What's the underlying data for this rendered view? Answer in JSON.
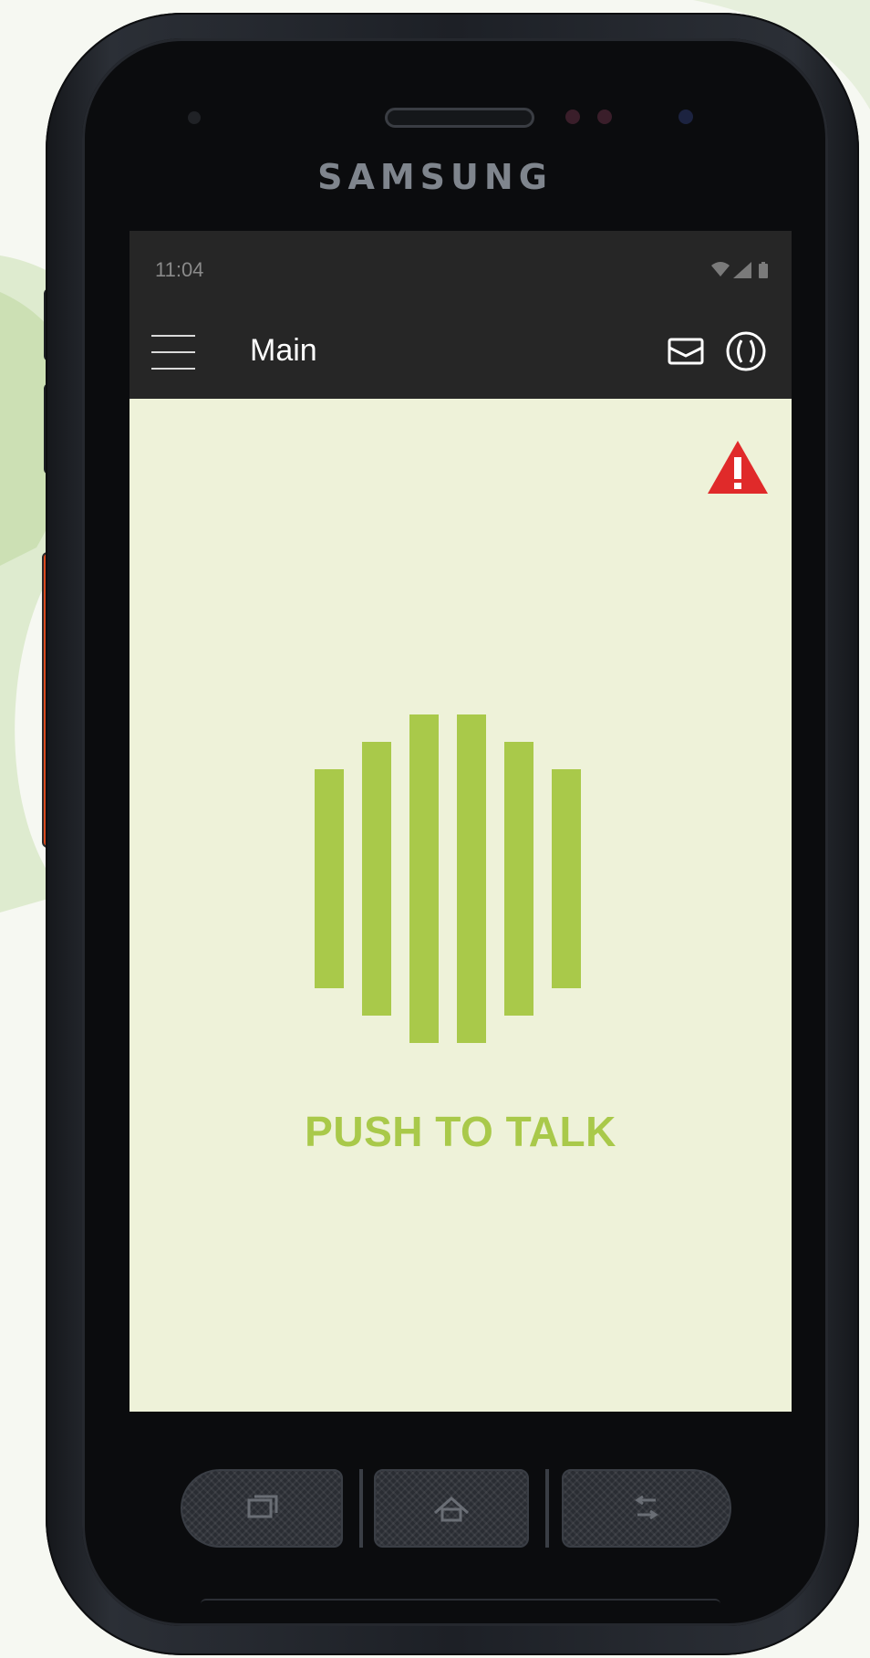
{
  "device": {
    "brand": "SAMSUNG"
  },
  "status_bar": {
    "time": "11:04",
    "icons": [
      "wifi-icon",
      "signal-icon",
      "battery-icon"
    ]
  },
  "app_bar": {
    "title": "Main",
    "menu_icon": "hamburger-menu-icon",
    "actions": [
      "mail-icon",
      "status-circle-icon"
    ]
  },
  "main": {
    "alert_icon": "warning-triangle-icon",
    "ptt_label": "PUSH TO TALK",
    "ptt_icon": "voice-bars-icon"
  },
  "hardware_keys": [
    "recent-apps-icon",
    "home-icon",
    "back-icon"
  ],
  "colors": {
    "screen_bg": "#eef2d9",
    "bar_bg": "#262626",
    "accent_green": "#a9c94a",
    "alert_red": "#e02a2a"
  }
}
